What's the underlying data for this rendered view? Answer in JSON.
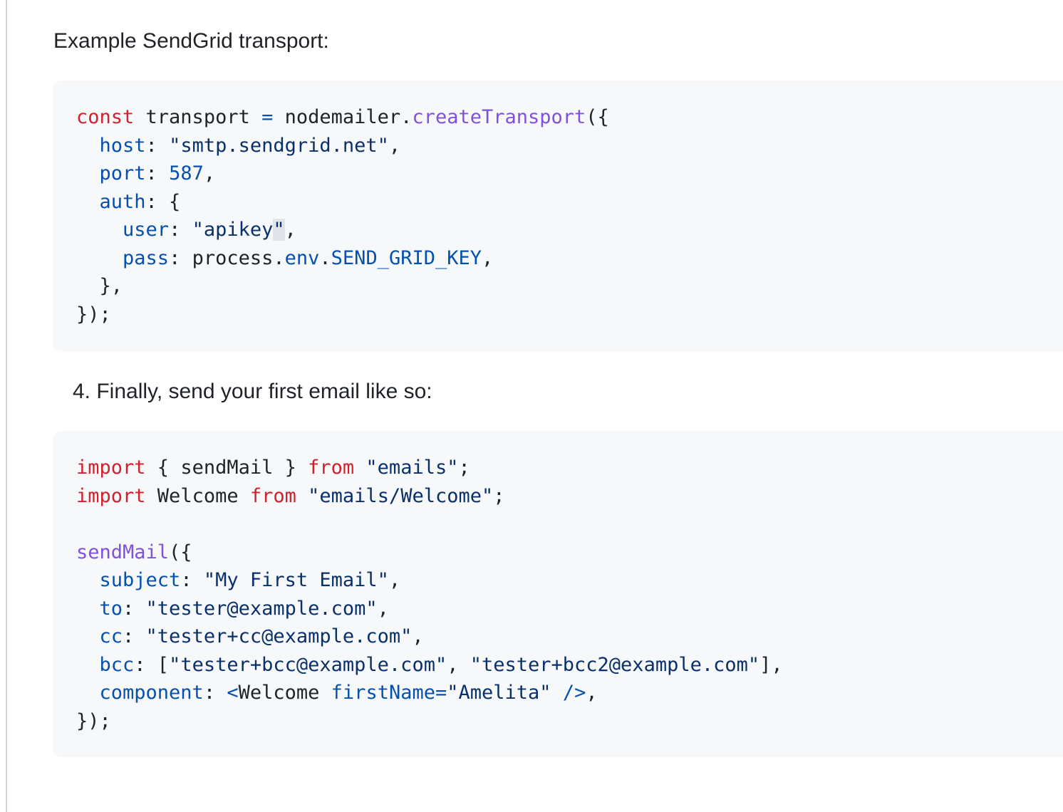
{
  "intro_text": "Example SendGrid transport:",
  "step4_text": "4. Finally, send your first email like so:",
  "transport_code": {
    "l1": {
      "kw": "const",
      "a": " transport ",
      "op": "=",
      "b": " nodemailer.",
      "fn": "createTransport",
      "c": "({"
    },
    "l2": {
      "indent": "  ",
      "prop": "host",
      "a": ": ",
      "str": "\"smtp.sendgrid.net\"",
      "b": ","
    },
    "l3": {
      "indent": "  ",
      "prop": "port",
      "a": ": ",
      "num": "587",
      "b": ","
    },
    "l4": {
      "indent": "  ",
      "prop": "auth",
      "a": ": {"
    },
    "l5": {
      "indent": "    ",
      "prop": "user",
      "a": ": ",
      "str": "\"apikey",
      "q": "\"",
      "b": ","
    },
    "l6": {
      "indent": "    ",
      "prop": "pass",
      "a": ": process.",
      "env": "env",
      "dot": ".",
      "key": "SEND_GRID_KEY",
      "b": ","
    },
    "l7": {
      "text": "  },"
    },
    "l8": {
      "text": "});"
    }
  },
  "sendmail_code": {
    "l1": {
      "kw1": "import",
      "a": " { sendMail } ",
      "kw2": "from",
      "b": " ",
      "str": "\"emails\"",
      "c": ";"
    },
    "l2": {
      "kw1": "import",
      "a": " Welcome ",
      "kw2": "from",
      "b": " ",
      "str": "\"emails/Welcome\"",
      "c": ";"
    },
    "l4": {
      "fn": "sendMail",
      "a": "({"
    },
    "l5": {
      "indent": "  ",
      "prop": "subject",
      "a": ": ",
      "str": "\"My First Email\"",
      "b": ","
    },
    "l6": {
      "indent": "  ",
      "prop": "to",
      "a": ": ",
      "str": "\"tester@example.com\"",
      "b": ","
    },
    "l7": {
      "indent": "  ",
      "prop": "cc",
      "a": ": ",
      "str": "\"tester+cc@example.com\"",
      "b": ","
    },
    "l8": {
      "indent": "  ",
      "prop": "bcc",
      "a": ": [",
      "str1": "\"tester+bcc@example.com\"",
      "sep": ", ",
      "str2": "\"tester+bcc2@example.com\"",
      "b": "],"
    },
    "l9": {
      "indent": "  ",
      "prop": "component",
      "a": ": ",
      "lt": "<",
      "tag": "Welcome",
      "sp": " ",
      "attr": "firstName",
      "eq": "=",
      "str": "\"Amelita\"",
      "sp2": " ",
      "close": "/>",
      "b": ","
    },
    "l10": {
      "text": "});"
    }
  },
  "colors": {
    "keyword": "#cf222e",
    "function": "#8250df",
    "property": "#0550ae",
    "string": "#0a3069",
    "code_background": "#f6f8fa",
    "text": "#1f2328"
  }
}
